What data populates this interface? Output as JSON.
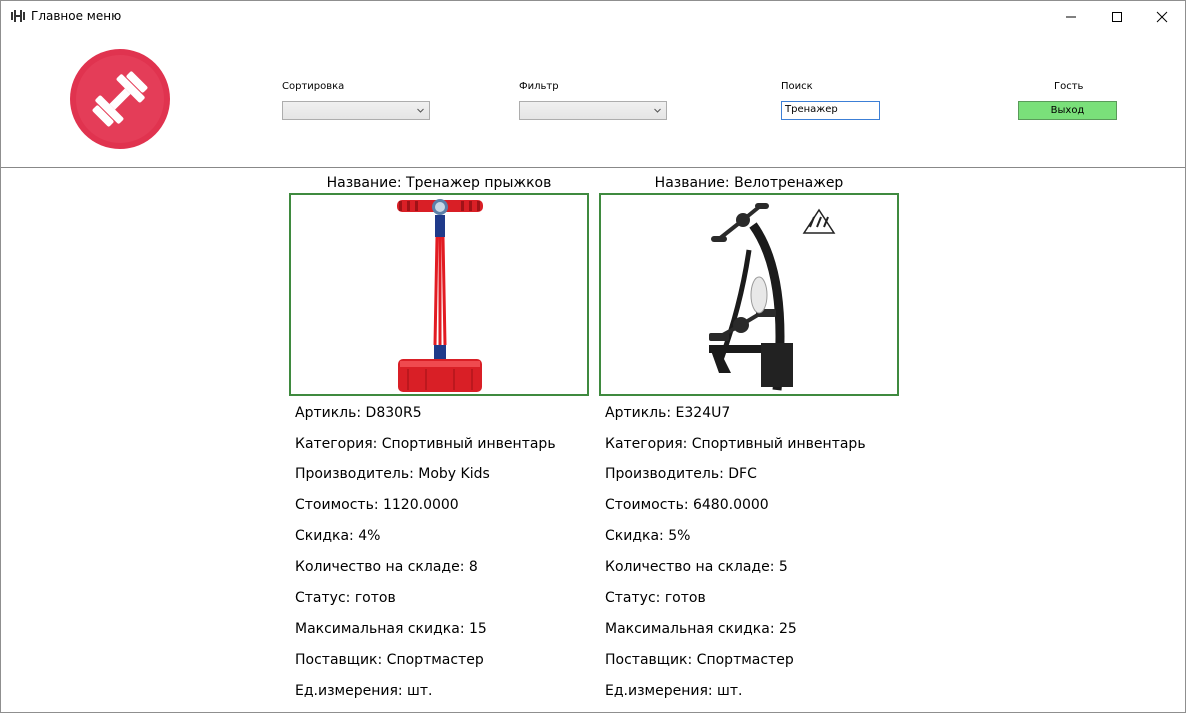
{
  "window": {
    "title": "Главное меню"
  },
  "header": {
    "sort_label": "Сортировка",
    "sort_value": "",
    "filter_label": "Фильтр",
    "filter_value": "",
    "search_label": "Поиск",
    "search_value": "Тренажер",
    "user_label": "Гость",
    "exit_label": "Выход"
  },
  "products": [
    {
      "title": "Название: Тренажер прыжков",
      "article": "Артикль: D830R5",
      "category": "Категория: Спортивный инвентарь",
      "manufacturer": "Производитель: Moby Kids",
      "price": "Стоимость: 1120.0000",
      "discount": "Скидка: 4%",
      "stock": "Количество на складе: 8",
      "status": "Статус: готов",
      "max_discount": "Максимальная скидка: 15",
      "supplier": "Поставщик: Спортмастер",
      "unit": "Ед.измерения: шт."
    },
    {
      "title": "Название: Велотренажер",
      "article": "Артикль: E324U7",
      "category": "Категория: Спортивный инвентарь",
      "manufacturer": "Производитель: DFC",
      "price": "Стоимость: 6480.0000",
      "discount": "Скидка: 5%",
      "stock": "Количество на складе: 5",
      "status": "Статус: готов",
      "max_discount": "Максимальная скидка: 25",
      "supplier": "Поставщик: Спортмастер",
      "unit": "Ед.измерения: шт."
    }
  ],
  "colors": {
    "logo": "#e0334f",
    "exit_button": "#7ae07a",
    "card_border": "#3f8a3f"
  }
}
